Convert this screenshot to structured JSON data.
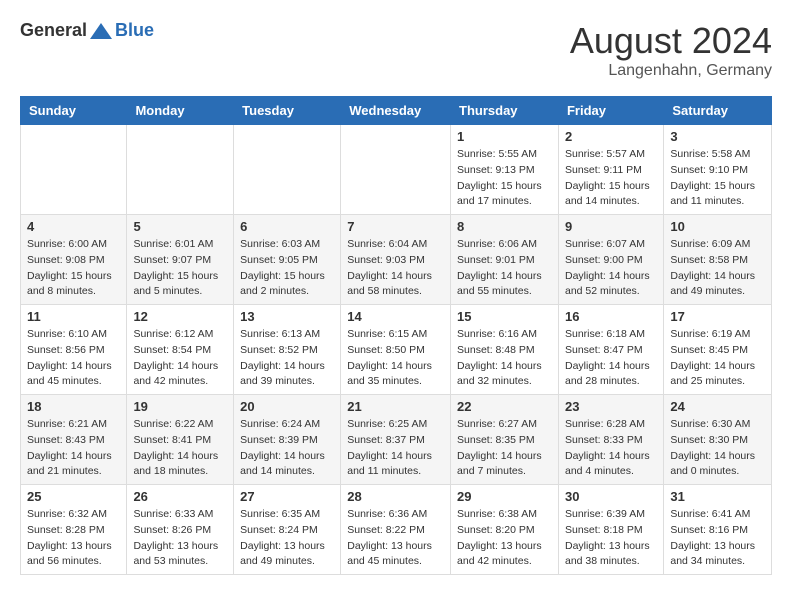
{
  "header": {
    "logo_general": "General",
    "logo_blue": "Blue",
    "month_title": "August 2024",
    "location": "Langenhahn, Germany"
  },
  "weekdays": [
    "Sunday",
    "Monday",
    "Tuesday",
    "Wednesday",
    "Thursday",
    "Friday",
    "Saturday"
  ],
  "weeks": [
    [
      {
        "day": "",
        "info": ""
      },
      {
        "day": "",
        "info": ""
      },
      {
        "day": "",
        "info": ""
      },
      {
        "day": "",
        "info": ""
      },
      {
        "day": "1",
        "info": "Sunrise: 5:55 AM\nSunset: 9:13 PM\nDaylight: 15 hours and 17 minutes."
      },
      {
        "day": "2",
        "info": "Sunrise: 5:57 AM\nSunset: 9:11 PM\nDaylight: 15 hours and 14 minutes."
      },
      {
        "day": "3",
        "info": "Sunrise: 5:58 AM\nSunset: 9:10 PM\nDaylight: 15 hours and 11 minutes."
      }
    ],
    [
      {
        "day": "4",
        "info": "Sunrise: 6:00 AM\nSunset: 9:08 PM\nDaylight: 15 hours and 8 minutes."
      },
      {
        "day": "5",
        "info": "Sunrise: 6:01 AM\nSunset: 9:07 PM\nDaylight: 15 hours and 5 minutes."
      },
      {
        "day": "6",
        "info": "Sunrise: 6:03 AM\nSunset: 9:05 PM\nDaylight: 15 hours and 2 minutes."
      },
      {
        "day": "7",
        "info": "Sunrise: 6:04 AM\nSunset: 9:03 PM\nDaylight: 14 hours and 58 minutes."
      },
      {
        "day": "8",
        "info": "Sunrise: 6:06 AM\nSunset: 9:01 PM\nDaylight: 14 hours and 55 minutes."
      },
      {
        "day": "9",
        "info": "Sunrise: 6:07 AM\nSunset: 9:00 PM\nDaylight: 14 hours and 52 minutes."
      },
      {
        "day": "10",
        "info": "Sunrise: 6:09 AM\nSunset: 8:58 PM\nDaylight: 14 hours and 49 minutes."
      }
    ],
    [
      {
        "day": "11",
        "info": "Sunrise: 6:10 AM\nSunset: 8:56 PM\nDaylight: 14 hours and 45 minutes."
      },
      {
        "day": "12",
        "info": "Sunrise: 6:12 AM\nSunset: 8:54 PM\nDaylight: 14 hours and 42 minutes."
      },
      {
        "day": "13",
        "info": "Sunrise: 6:13 AM\nSunset: 8:52 PM\nDaylight: 14 hours and 39 minutes."
      },
      {
        "day": "14",
        "info": "Sunrise: 6:15 AM\nSunset: 8:50 PM\nDaylight: 14 hours and 35 minutes."
      },
      {
        "day": "15",
        "info": "Sunrise: 6:16 AM\nSunset: 8:48 PM\nDaylight: 14 hours and 32 minutes."
      },
      {
        "day": "16",
        "info": "Sunrise: 6:18 AM\nSunset: 8:47 PM\nDaylight: 14 hours and 28 minutes."
      },
      {
        "day": "17",
        "info": "Sunrise: 6:19 AM\nSunset: 8:45 PM\nDaylight: 14 hours and 25 minutes."
      }
    ],
    [
      {
        "day": "18",
        "info": "Sunrise: 6:21 AM\nSunset: 8:43 PM\nDaylight: 14 hours and 21 minutes."
      },
      {
        "day": "19",
        "info": "Sunrise: 6:22 AM\nSunset: 8:41 PM\nDaylight: 14 hours and 18 minutes."
      },
      {
        "day": "20",
        "info": "Sunrise: 6:24 AM\nSunset: 8:39 PM\nDaylight: 14 hours and 14 minutes."
      },
      {
        "day": "21",
        "info": "Sunrise: 6:25 AM\nSunset: 8:37 PM\nDaylight: 14 hours and 11 minutes."
      },
      {
        "day": "22",
        "info": "Sunrise: 6:27 AM\nSunset: 8:35 PM\nDaylight: 14 hours and 7 minutes."
      },
      {
        "day": "23",
        "info": "Sunrise: 6:28 AM\nSunset: 8:33 PM\nDaylight: 14 hours and 4 minutes."
      },
      {
        "day": "24",
        "info": "Sunrise: 6:30 AM\nSunset: 8:30 PM\nDaylight: 14 hours and 0 minutes."
      }
    ],
    [
      {
        "day": "25",
        "info": "Sunrise: 6:32 AM\nSunset: 8:28 PM\nDaylight: 13 hours and 56 minutes."
      },
      {
        "day": "26",
        "info": "Sunrise: 6:33 AM\nSunset: 8:26 PM\nDaylight: 13 hours and 53 minutes."
      },
      {
        "day": "27",
        "info": "Sunrise: 6:35 AM\nSunset: 8:24 PM\nDaylight: 13 hours and 49 minutes."
      },
      {
        "day": "28",
        "info": "Sunrise: 6:36 AM\nSunset: 8:22 PM\nDaylight: 13 hours and 45 minutes."
      },
      {
        "day": "29",
        "info": "Sunrise: 6:38 AM\nSunset: 8:20 PM\nDaylight: 13 hours and 42 minutes."
      },
      {
        "day": "30",
        "info": "Sunrise: 6:39 AM\nSunset: 8:18 PM\nDaylight: 13 hours and 38 minutes."
      },
      {
        "day": "31",
        "info": "Sunrise: 6:41 AM\nSunset: 8:16 PM\nDaylight: 13 hours and 34 minutes."
      }
    ]
  ]
}
